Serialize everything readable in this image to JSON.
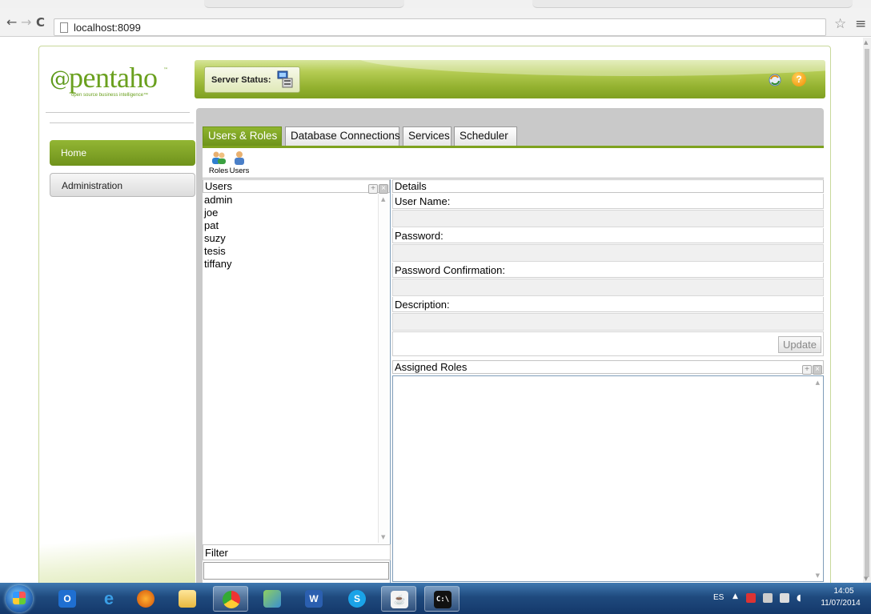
{
  "browser": {
    "url": "localhost:8099"
  },
  "header": {
    "server_status_label": "Server Status:",
    "logo_word": "pentaho",
    "logo_tm": "™",
    "logo_tagline": "open source business intelligence™"
  },
  "nav": {
    "items": [
      {
        "label": "Home",
        "active": true
      },
      {
        "label": "Administration",
        "active": false
      }
    ]
  },
  "tabs": [
    {
      "label": "Users & Roles",
      "active": true
    },
    {
      "label": "Database Connections",
      "active": false
    },
    {
      "label": "Services",
      "active": false
    },
    {
      "label": "Scheduler",
      "active": false
    }
  ],
  "subtoolbar": {
    "roles_label": "Roles",
    "users_label": "Users"
  },
  "users_panel": {
    "title": "Users",
    "users": [
      "admin",
      "joe",
      "pat",
      "suzy",
      "tesis",
      "tiffany"
    ],
    "filter_label": "Filter",
    "filter_value": ""
  },
  "details": {
    "title": "Details",
    "fields": [
      {
        "label": "User Name:",
        "value": ""
      },
      {
        "label": "Password:",
        "value": ""
      },
      {
        "label": "Password Confirmation:",
        "value": ""
      },
      {
        "label": "Description:",
        "value": ""
      }
    ],
    "update_label": "Update",
    "assigned_roles_title": "Assigned Roles"
  },
  "taskbar": {
    "language": "ES",
    "time": "14:05",
    "date": "11/07/2014"
  },
  "colors": {
    "pentaho_green": "#7ea21f",
    "taskbar_blue": "#1f4a7e"
  }
}
